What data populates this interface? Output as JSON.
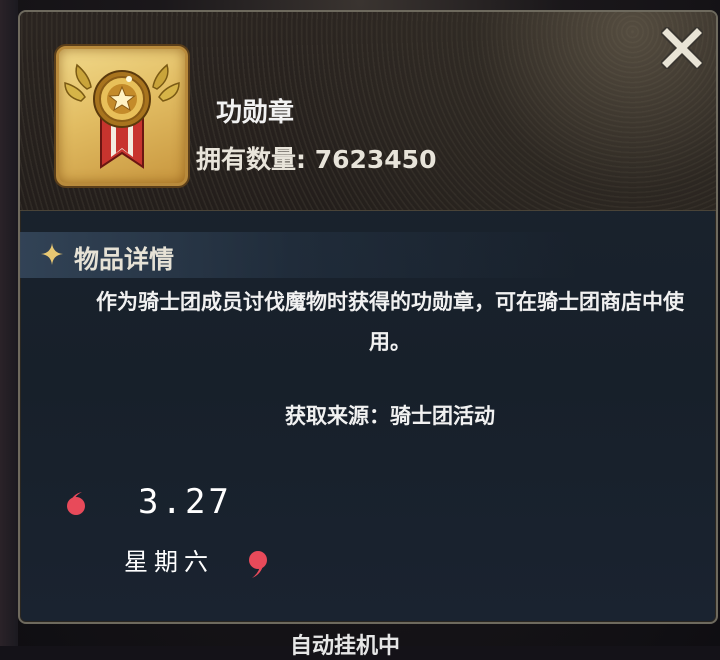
{
  "item": {
    "name": "功勋章",
    "count_label": "拥有数量: 7623450",
    "icon": "medal-icon"
  },
  "details": {
    "section_title": "物品详情",
    "description": "作为骑士团成员讨伐魔物时获得的功勋章，可在骑士团商店中使用。",
    "source": "获取来源：骑士团活动"
  },
  "overlay": {
    "date": "3.27",
    "weekday": "星期六"
  },
  "footer": {
    "partial_text": "自动挂机中"
  },
  "colors": {
    "panel_border": "#6e6a5e",
    "gold": "#e2bd63",
    "quote_red": "#e84a5a"
  }
}
